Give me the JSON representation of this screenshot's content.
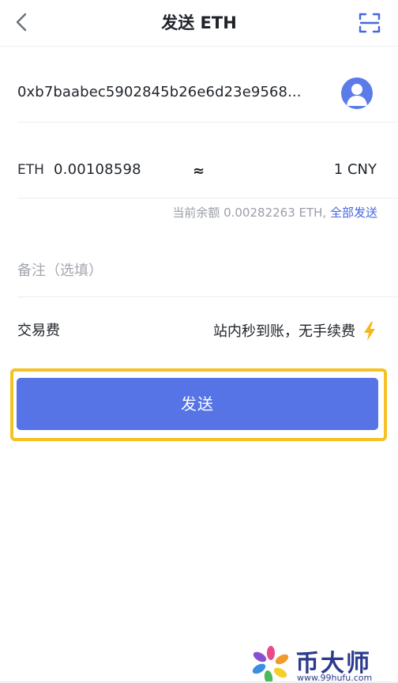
{
  "header": {
    "title": "发送 ETH",
    "back_icon": "chevron-left-icon",
    "scan_icon": "scan-icon"
  },
  "recipient": {
    "address": "0xb7baabec5902845b26e6d23e9568...",
    "avatar_icon": "user-avatar-icon"
  },
  "amount": {
    "unit": "ETH",
    "value": "0.00108598",
    "approx": "≈",
    "fiat": "1 CNY"
  },
  "balance": {
    "text": "当前余额 0.00282263 ETH,",
    "send_all": "全部发送"
  },
  "memo": {
    "placeholder": "备注（选填）",
    "value": ""
  },
  "fee": {
    "label": "交易费",
    "value": "站内秒到账，无手续费",
    "icon": "lightning-icon"
  },
  "send_button": {
    "label": "发送"
  },
  "watermark": {
    "text": "币大师",
    "url": "www.99hufu.com"
  },
  "colors": {
    "accent": "#5674e6",
    "link": "#4566e0",
    "highlight": "#f5c125",
    "muted": "#9a9ea6"
  }
}
